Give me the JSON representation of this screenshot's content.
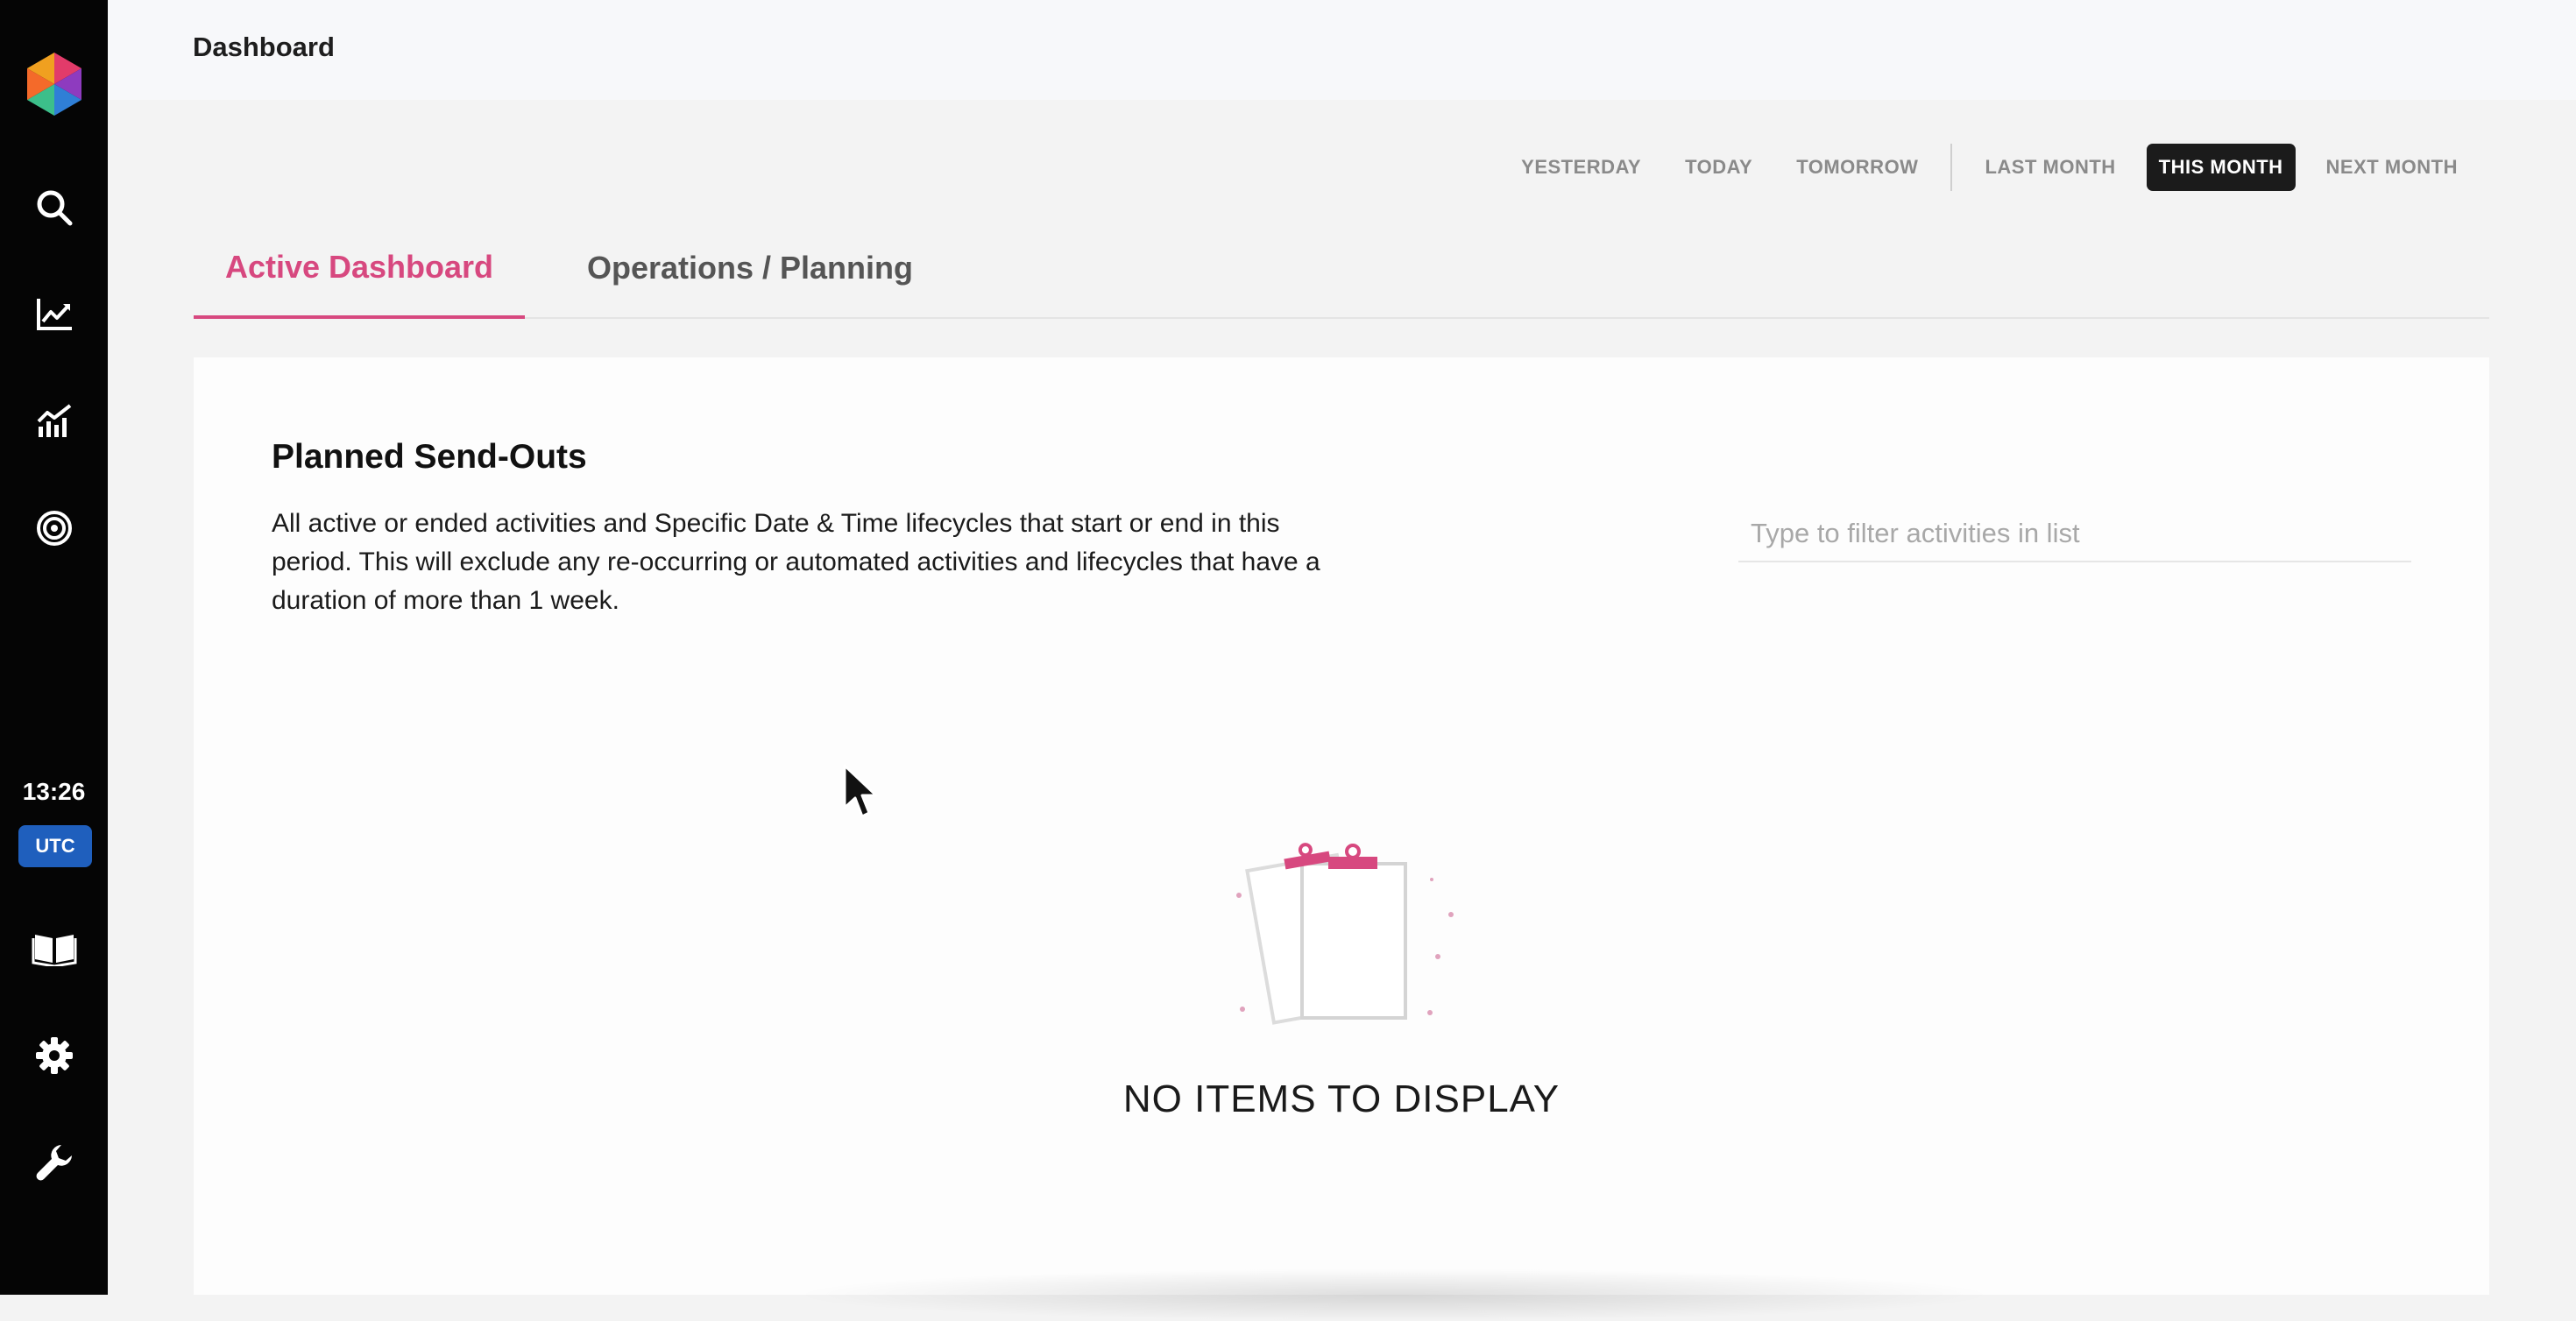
{
  "topbar": {
    "title": "Dashboard"
  },
  "sidebar": {
    "items": [
      {
        "icon": "search-icon"
      },
      {
        "icon": "chart-line-icon"
      },
      {
        "icon": "analytics-icon"
      },
      {
        "icon": "target-icon"
      },
      {
        "icon": "book-icon"
      },
      {
        "icon": "gear-icon"
      },
      {
        "icon": "wrench-icon"
      }
    ],
    "clock": "13:26",
    "timezone": "UTC"
  },
  "date_range": {
    "options": [
      "YESTERDAY",
      "TODAY",
      "TOMORROW",
      "LAST MONTH",
      "THIS MONTH",
      "NEXT MONTH"
    ],
    "selected": "THIS MONTH"
  },
  "tabs": [
    {
      "label": "Active Dashboard",
      "active": true
    },
    {
      "label": "Operations / Planning",
      "active": false
    }
  ],
  "card": {
    "title": "Planned Send-Outs",
    "description": "All active or ended activities and Specific Date & Time lifecycles that start or end in this period. This will exclude any re-occurring or automated activities and lifecycles that have a duration of more than 1 week.",
    "filter_placeholder": "Type to filter activities in list",
    "filter_value": "",
    "empty_message": "NO ITEMS TO DISPLAY"
  },
  "colors": {
    "accent": "#d7487f",
    "sidebar_bg": "#050505",
    "timezone_badge": "#1f5fbd",
    "active_range_bg": "#1b1b1b"
  }
}
